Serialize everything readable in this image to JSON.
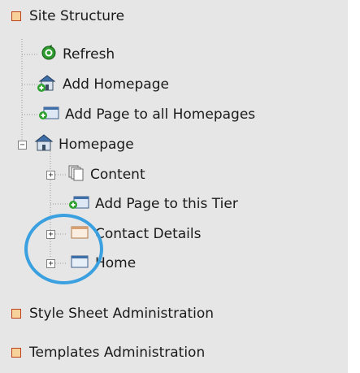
{
  "tree": {
    "root_label": "Site Structure",
    "items": [
      {
        "label": "Refresh",
        "icon": "refresh-icon"
      },
      {
        "label": "Add Homepage",
        "icon": "add-homepage-icon"
      },
      {
        "label": "Add Page to all Homepages",
        "icon": "add-page-icon"
      },
      {
        "label": "Homepage",
        "icon": "homepage-icon"
      },
      {
        "label": "Content",
        "icon": "content-pages-icon"
      },
      {
        "label": "Add Page to this Tier",
        "icon": "add-page-icon"
      },
      {
        "label": "Contact Details",
        "icon": "page-icon"
      },
      {
        "label": "Home",
        "icon": "page-icon"
      }
    ],
    "expander_plus": "+",
    "expander_minus": "−"
  },
  "sections": [
    {
      "label": "Style Sheet Administration"
    },
    {
      "label": "Templates Administration"
    }
  ],
  "colors": {
    "panel_bg": "#e6e6e6",
    "bullet_fill": "#f6d29a",
    "bullet_border": "#c0421a",
    "highlight_circle": "#3aa0e0"
  }
}
